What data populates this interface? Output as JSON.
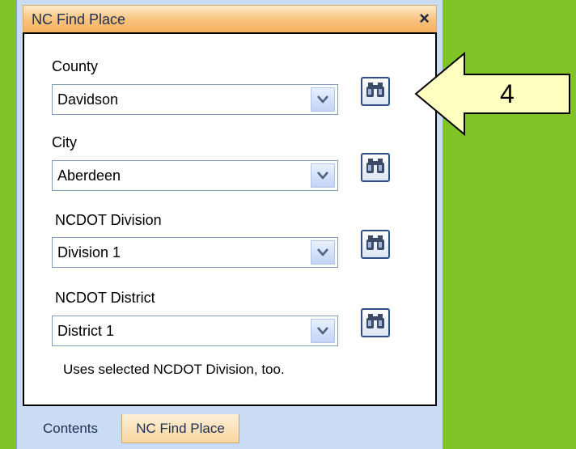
{
  "window": {
    "title": "NC Find Place",
    "close_glyph": "×"
  },
  "fields": [
    {
      "label": "County",
      "value": "Davidson"
    },
    {
      "label": "City",
      "value": "Aberdeen"
    },
    {
      "label": "NCDOT Division",
      "value": "Division 1"
    },
    {
      "label": "NCDOT District",
      "value": "District 1"
    }
  ],
  "note": "Uses selected NCDOT Division, too.",
  "tabs": [
    {
      "label": "Contents",
      "active": false
    },
    {
      "label": "NC Find Place",
      "active": true
    }
  ],
  "callout": {
    "number": "4",
    "fill": "#ffffc0"
  },
  "colors": {
    "background": "#80c427",
    "title_gradient_bottom": "#f6b060",
    "active_tab": "#f9d69f"
  },
  "icons": [
    "close-icon",
    "chevron-down-icon",
    "binoculars-icon"
  ]
}
